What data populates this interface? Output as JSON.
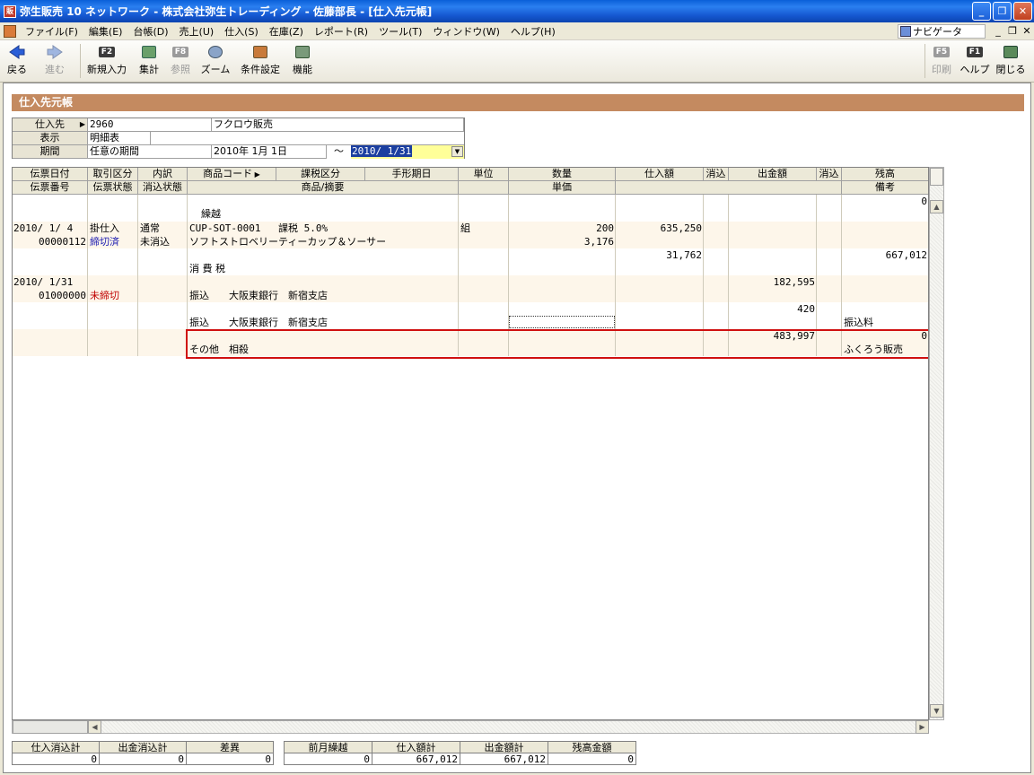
{
  "window": {
    "title": "弥生販売 10 ネットワーク - 株式会社弥生トレーディング - 佐藤部長 - [仕入先元帳]",
    "app_icon": "販",
    "minimize": "_",
    "maximize": "❐",
    "close": "✕"
  },
  "menu": {
    "items": [
      "ファイル(F)",
      "編集(E)",
      "台帳(D)",
      "売上(U)",
      "仕入(S)",
      "在庫(Z)",
      "レポート(R)",
      "ツール(T)",
      "ウィンドウ(W)",
      "ヘルプ(H)"
    ],
    "navigator": "ナビゲータ",
    "mdi_min": "_",
    "mdi_restore": "❐",
    "mdi_close": "✕"
  },
  "toolbar": {
    "back": "戻る",
    "forward": "進む",
    "new_entry": {
      "key": "F2",
      "label": "新規入力"
    },
    "aggregate": "集計",
    "reference": {
      "key": "F8",
      "label": "参照"
    },
    "zoom": "ズーム",
    "conditions": "条件設定",
    "functions": "機能",
    "print": {
      "key": "F5",
      "label": "印刷"
    },
    "help": {
      "key": "F1",
      "label": "ヘルプ"
    },
    "close": "閉じる"
  },
  "page": {
    "section_title": "仕入先元帳"
  },
  "header": {
    "supplier_label": "仕入先",
    "supplier_code": "2960",
    "supplier_name": "フクロウ販売",
    "display_label": "表示",
    "display_value": "明細表",
    "period_label": "期間",
    "period_type": "任意の期間",
    "period_from": "2010年 1月 1日",
    "period_sep": "～",
    "period_to": "2010/ 1/31"
  },
  "grid": {
    "header_row1": [
      "伝票日付",
      "取引区分",
      "内訳",
      "商品コード",
      "課税区分",
      "手形期日",
      "単位",
      "数量",
      "仕入額",
      "消込",
      "出金額",
      "消込",
      "残高"
    ],
    "header_row2": [
      "伝票番号",
      "伝票状態",
      "消込状態",
      "商品/摘要",
      "単価",
      "備考"
    ],
    "rows": {
      "carry_balance": "0",
      "carry_label": "繰越",
      "r1_date": "2010/ 1/ 4",
      "r1_type": "掛仕入",
      "r1_breakdown": "通常",
      "r1_code": "CUP-SOT-0001",
      "r1_tax": "課税 5.0%",
      "r1_unit": "組",
      "r1_qty": "200",
      "r1_purchase": "635,250",
      "r1_slip": "00000112",
      "r1_status": "締切済",
      "r1_clear": "未消込",
      "r1_item": "ソフトストロベリーティーカップ＆ソーサー",
      "r1_price": "3,176",
      "tax_purchase": "31,762",
      "tax_balance": "667,012",
      "tax_label": "消 費 税",
      "r2_date": "2010/ 1/31",
      "r2_payment": "182,595",
      "r2_slip": "01000000",
      "r2_status": "未締切",
      "r2_desc1": "振込　　大阪東銀行　新宿支店",
      "r2_fee": "420",
      "r2_desc2": "振込　　大阪東銀行　新宿支店",
      "r2_fee_note": "振込料",
      "r2_offset": "483,997",
      "r2_balance": "0",
      "r2_desc3": "その他　相殺",
      "r2_note": "ふくろう販売"
    }
  },
  "totals": {
    "purchase_cleared_label": "仕入消込計",
    "purchase_cleared": "0",
    "payment_cleared_label": "出金消込計",
    "payment_cleared": "0",
    "difference_label": "差異",
    "difference": "0",
    "prev_carry_label": "前月繰越",
    "prev_carry": "0",
    "purchase_total_label": "仕入額計",
    "purchase_total": "667,012",
    "payment_total_label": "出金額計",
    "payment_total": "667,012",
    "balance_label": "残高金額",
    "balance": "0"
  },
  "icons": {
    "back": "arrow-left-icon",
    "forward": "arrow-right-icon",
    "aggregate": "calculator-icon",
    "zoom": "magnifier-icon",
    "conditions": "settings-icon",
    "functions": "function-icon",
    "close": "exit-icon"
  }
}
